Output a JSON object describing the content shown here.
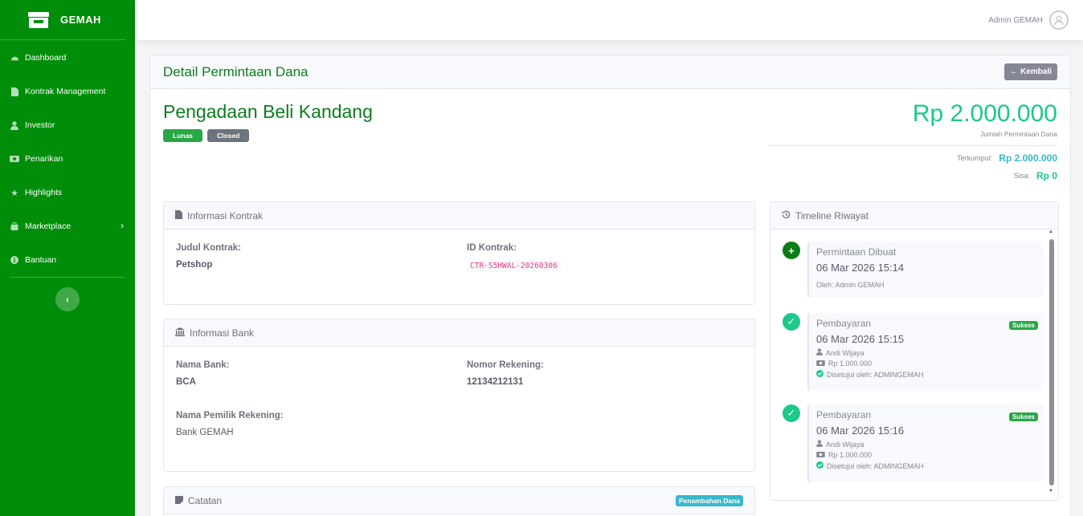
{
  "brand": {
    "name": "GEMAH"
  },
  "sidebar": {
    "items": [
      {
        "label": "Dashboard",
        "icon": "dashboard-icon"
      },
      {
        "label": "Kontrak Management",
        "icon": "file-icon"
      },
      {
        "label": "Investor",
        "icon": "user-icon"
      },
      {
        "label": "Penarikan",
        "icon": "money-icon"
      },
      {
        "label": "Highlights",
        "icon": "star-icon"
      },
      {
        "label": "Marketplace",
        "icon": "shop-icon"
      },
      {
        "label": "Bantuan",
        "icon": "info-icon"
      }
    ],
    "toggle": "‹"
  },
  "topbar": {
    "user_name": "Admin GEMAH"
  },
  "page": {
    "title": "Detail Permintaan Dana",
    "back_label": "Kembali",
    "project_title": "Pengadaan Beli Kandang",
    "badge_status": "Lunas",
    "badge_state": "Closed",
    "amount": "Rp 2.000.000",
    "amount_label": "Jumlah Permintaan Dana",
    "collected_label": "Terkumpul:",
    "collected_value": "Rp 2.000.000",
    "remaining_label": "Sisa:",
    "remaining_value": "Rp 0"
  },
  "contract_info": {
    "header": "Informasi Kontrak",
    "title_label": "Judul Kontrak:",
    "title_value": "Petshop",
    "id_label": "ID Kontrak:",
    "id_value": "CTR-S5HWAL-20260306"
  },
  "bank_info": {
    "header": "Informasi Bank",
    "bank_label": "Nama Bank:",
    "bank_value": "BCA",
    "account_label": "Nomor Rekening:",
    "account_value": "12134212131",
    "owner_label": "Nama Pemilik Rekening:",
    "owner_value": "Bank GEMAH"
  },
  "notes": {
    "header": "Catatan",
    "badge": "Penambahan Dana"
  },
  "timeline": {
    "header": "Timeline Riwayat",
    "items": [
      {
        "title": "Permintaan Dibuat",
        "date": "06 Mar 2026 15:14",
        "by": "Oleh: Admin GEMAH"
      },
      {
        "title": "Pembayaran",
        "date": "06 Mar 2026 15:15",
        "badge": "Sukses",
        "investor": "Andi Wijaya",
        "amount": "Rp 1.000.000",
        "approved": "Disetujui oleh: ADMINGEMAH"
      },
      {
        "title": "Pembayaran",
        "date": "06 Mar 2026 15:16",
        "badge": "Sukses",
        "investor": "Andi Wijaya",
        "amount": "Rp 1.000.000",
        "approved": "Disetujui oleh: ADMINGEMAH"
      }
    ]
  },
  "colors": {
    "sidebar": "#008d0a",
    "accent_green": "#1cc88a",
    "title_green": "#0c7d1e",
    "info": "#36b9cc"
  }
}
